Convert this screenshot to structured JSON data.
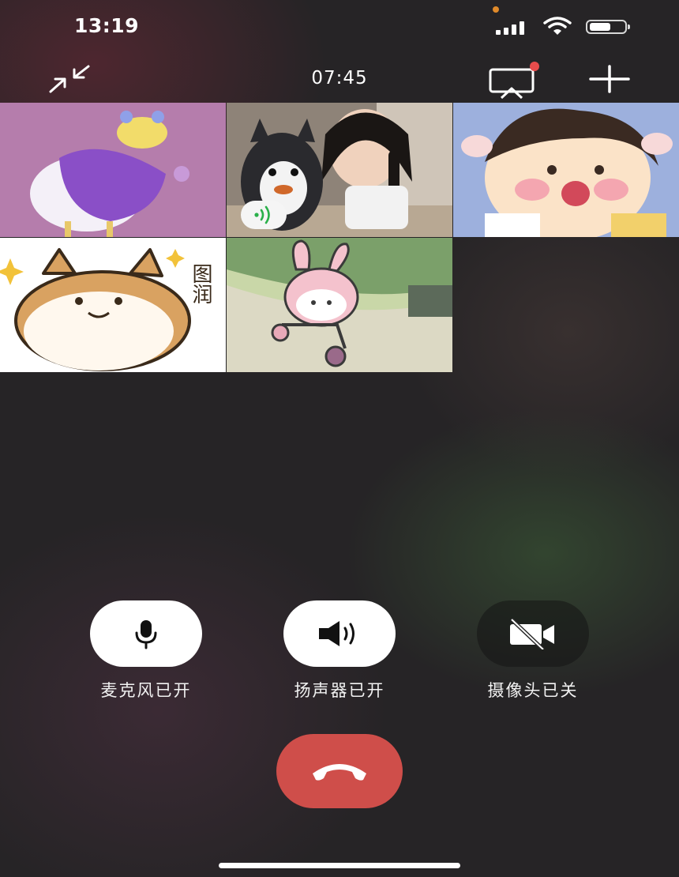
{
  "status_bar": {
    "time": "13:19",
    "icons": [
      "camera-in-use-dot",
      "signal-icon",
      "wifi-icon",
      "battery-icon"
    ],
    "colors": {
      "camera_dot": "#e08a2a"
    }
  },
  "call_bar": {
    "duration": "07:45",
    "icons": [
      "minimize-icon",
      "screen-cast-icon",
      "add-icon"
    ],
    "notification_dot_color": "#e84c4c"
  },
  "participants": [
    {
      "avatar": "purple-cartoon-girl-avatar"
    },
    {
      "avatar": "girl-with-husky-plush-avatar",
      "speaking": true,
      "speaking_icon": "sound-wave-icon"
    },
    {
      "avatar": "cartoon-boy-with-horns-avatar"
    },
    {
      "avatar": "shiba-dog-sticker-avatar",
      "sticker_text": "图润"
    },
    {
      "avatar": "bunny-on-scooter-avatar"
    }
  ],
  "controls": {
    "microphone": {
      "label": "麦克风已开",
      "state": "on",
      "icon": "microphone-icon"
    },
    "speaker": {
      "label": "扬声器已开",
      "state": "on",
      "icon": "speaker-icon"
    },
    "camera": {
      "label": "摄像头已关",
      "state": "off",
      "icon": "camera-off-icon"
    }
  },
  "hangup": {
    "icon": "hang-up-icon",
    "color": "#cf4e4a"
  }
}
